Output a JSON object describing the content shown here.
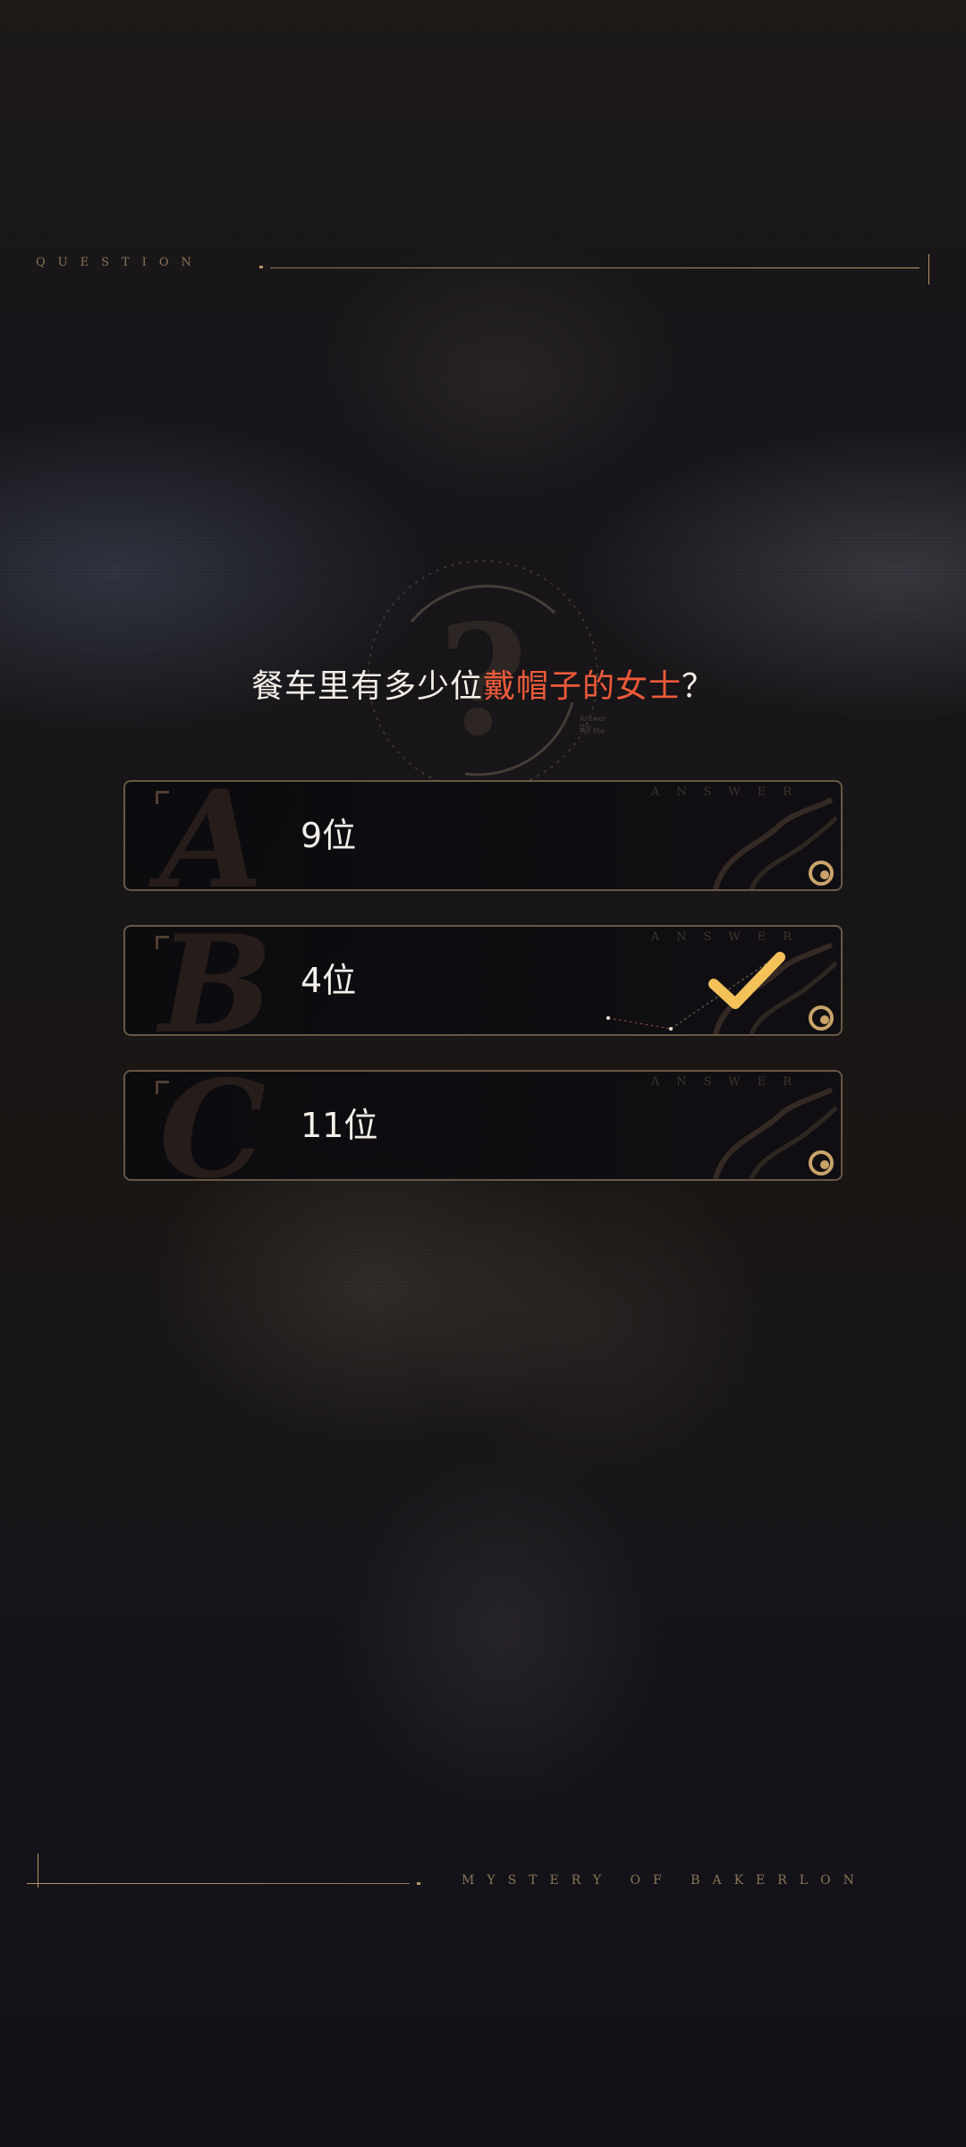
{
  "header": {
    "label": "QUESTION"
  },
  "question": {
    "prefix": "餐车里有多少位",
    "highlight": "戴帽子的女士",
    "suffix": "？",
    "highlight_color": "#ee5a3a"
  },
  "emblem": {
    "glyph": "?",
    "line1": "Answer the  ...",
    "line2": "For the  ..."
  },
  "answers": [
    {
      "letter": "A",
      "text": "9位",
      "tag": "ANSWER",
      "selected": false
    },
    {
      "letter": "B",
      "text": "4位",
      "tag": "ANSWER",
      "selected": true
    },
    {
      "letter": "C",
      "text": "11位",
      "tag": "ANSWER",
      "selected": false
    }
  ],
  "footer": {
    "label": "MYSTERY OF BAKERLON"
  },
  "colors": {
    "accent_gold": "#c9a36a",
    "check_gold": "#f5c25a",
    "text": "#f4f0ea"
  }
}
